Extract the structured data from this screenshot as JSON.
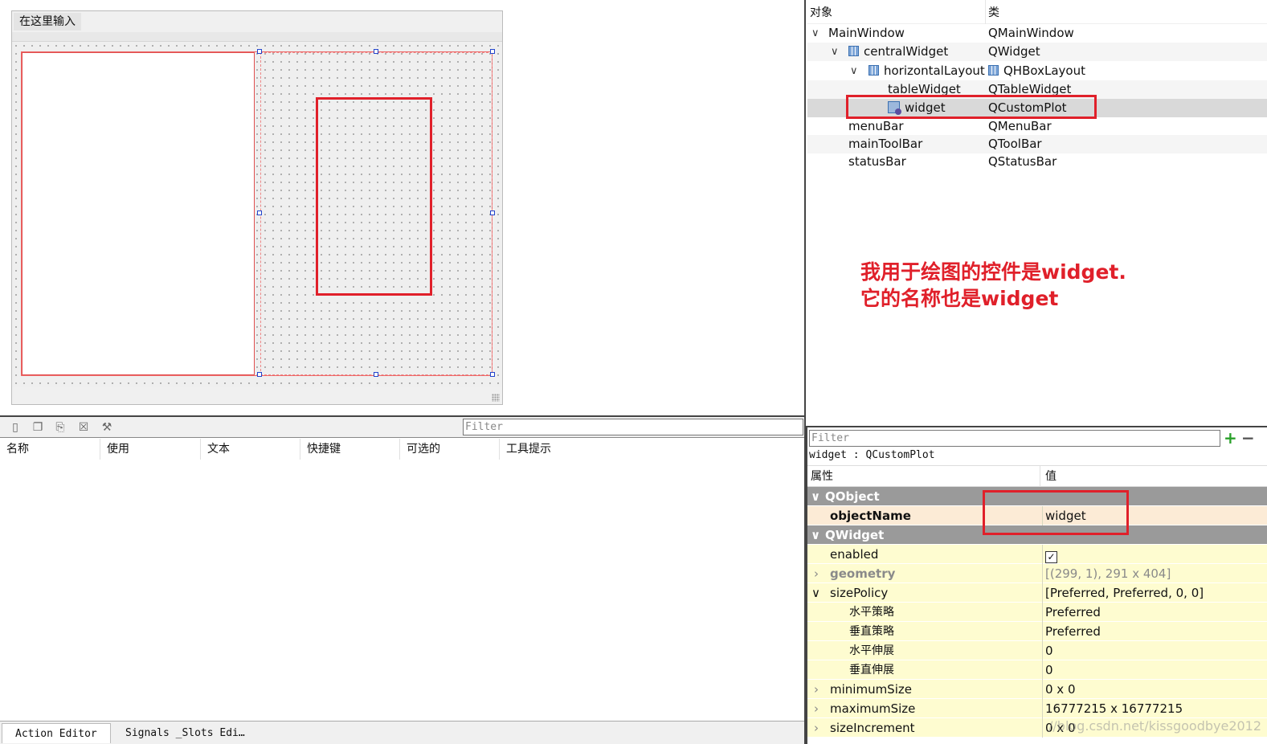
{
  "designer": {
    "menu_placeholder": "在这里输入"
  },
  "action_editor": {
    "filter_placeholder": "Filter",
    "toolbar_icons": [
      "new-action-icon",
      "copy-icon",
      "paste-icon",
      "delete-icon",
      "configure-icon"
    ],
    "columns": [
      "名称",
      "使用",
      "文本",
      "快捷键",
      "可选的",
      "工具提示"
    ],
    "tabs": [
      "Action Editor",
      "Signals _Slots Edi…"
    ]
  },
  "object_inspector": {
    "headers": {
      "object": "对象",
      "class": "类"
    },
    "rows": [
      {
        "name": "MainWindow",
        "class": "QMainWindow"
      },
      {
        "name": "centralWidget",
        "class": "QWidget"
      },
      {
        "name": "horizontalLayout",
        "class": "QHBoxLayout"
      },
      {
        "name": "tableWidget",
        "class": "QTableWidget"
      },
      {
        "name": "widget",
        "class": "QCustomPlot"
      },
      {
        "name": "menuBar",
        "class": "QMenuBar"
      },
      {
        "name": "mainToolBar",
        "class": "QToolBar"
      },
      {
        "name": "statusBar",
        "class": "QStatusBar"
      }
    ],
    "annotation_line1": "我用于绘图的控件是widget.",
    "annotation_line2": "它的名称也是widget"
  },
  "property_editor": {
    "filter_placeholder": "Filter",
    "plus": "+",
    "minus": "−",
    "object_label": "widget : QCustomPlot",
    "headers": {
      "property": "属性",
      "value": "值"
    },
    "groups": {
      "qobject": "QObject",
      "qwidget": "QWidget"
    },
    "rows": {
      "objectName": {
        "name": "objectName",
        "value": "widget"
      },
      "enabled": {
        "name": "enabled",
        "value": "✓"
      },
      "geometry": {
        "name": "geometry",
        "value": "[(299, 1), 291 x 404]"
      },
      "sizePolicy": {
        "name": "sizePolicy",
        "value": "[Preferred, Preferred, 0, 0]"
      },
      "hpolicy": {
        "name": "水平策略",
        "value": "Preferred"
      },
      "vpolicy": {
        "name": "垂直策略",
        "value": "Preferred"
      },
      "hstretch": {
        "name": "水平伸展",
        "value": "0"
      },
      "vstretch": {
        "name": "垂直伸展",
        "value": "0"
      },
      "minimumSize": {
        "name": "minimumSize",
        "value": "0 x 0"
      },
      "maximumSize": {
        "name": "maximumSize",
        "value": "16777215 x 16777215"
      },
      "sizeIncrement": {
        "name": "sizeIncrement",
        "value": "0 x 0"
      }
    },
    "watermark": "//blog.csdn.net/kissgoodbye2012"
  },
  "colors": {
    "highlight_red": "#e0202a",
    "group_gray": "#9a9a9a",
    "object_row": "#fcebd6",
    "widget_row": "#fefcd0"
  }
}
